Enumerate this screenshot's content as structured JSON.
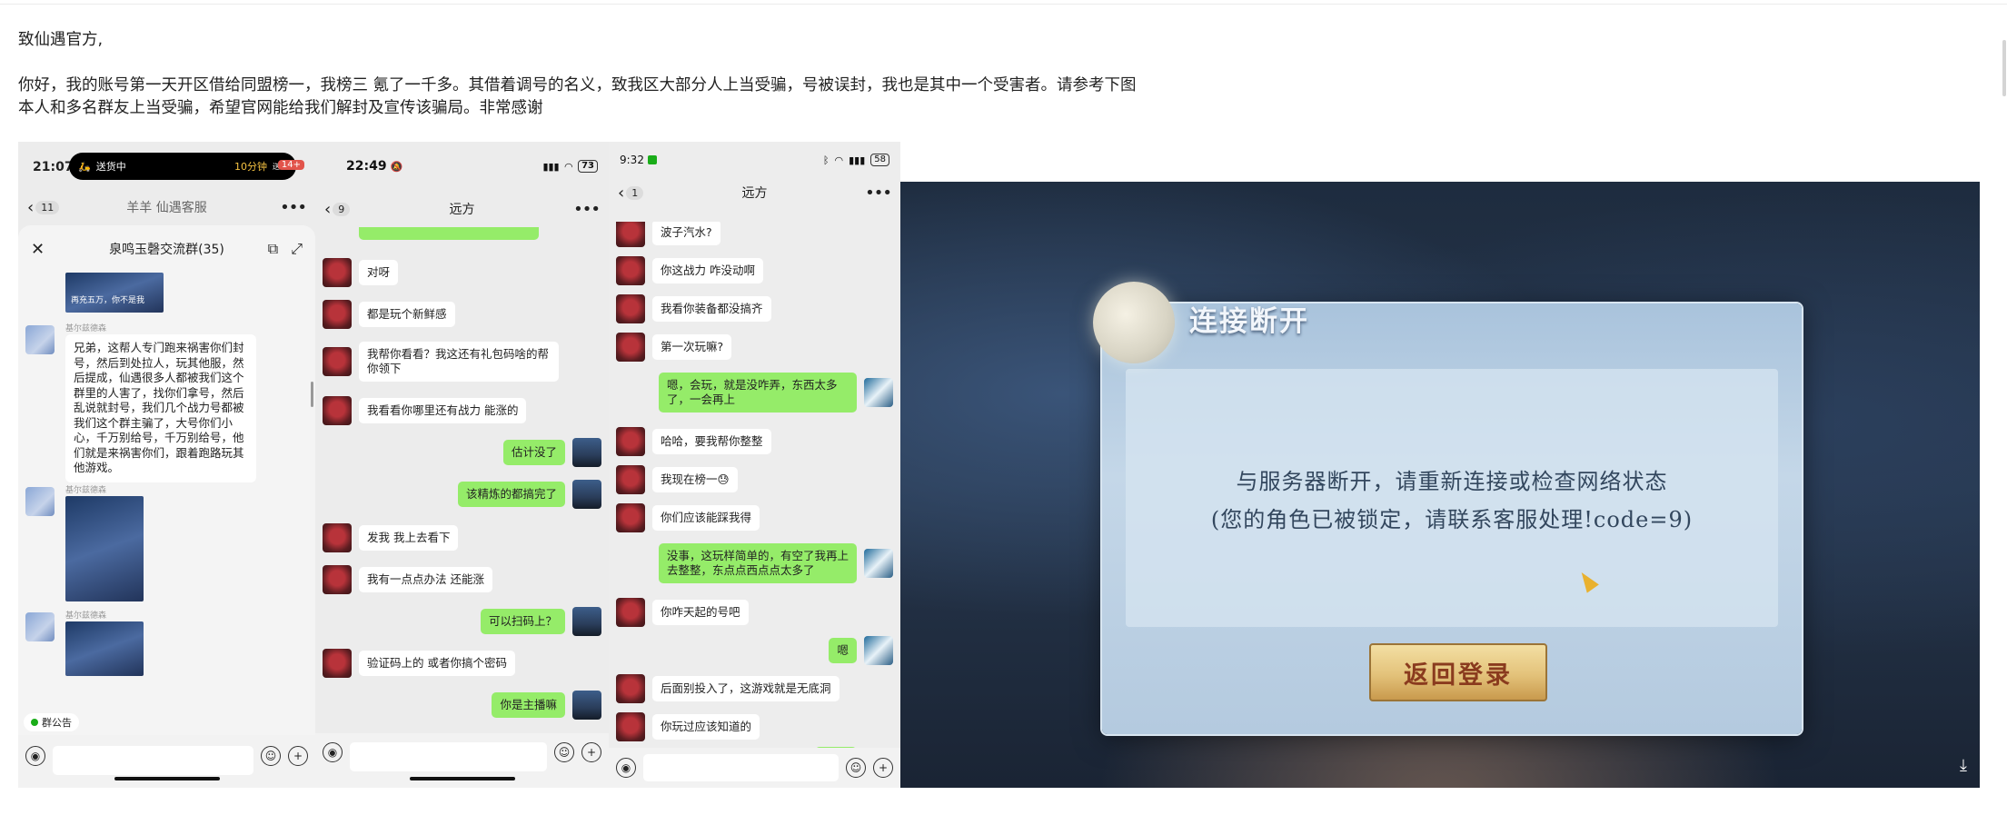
{
  "letter": {
    "salutation": "致仙遇官方,",
    "line1": "你好，我的账号第一天开区借给同盟榜一，我榜三 氪了一千多。其借着调号的名义，致我区大部分人上当受骗，号被误封，我也是其中一个受害者。请参考下图",
    "line2": "本人和多名群友上当受骗，希望官网能给我们解封及宣传该骗局。非常感谢"
  },
  "shot1": {
    "time": "21:07",
    "island_label": "送货中",
    "island_eta": "10分钟",
    "island_eta_suffix": "送达",
    "battery": "14+",
    "back_count": "11",
    "nav_title": "羊羊 仙遇客服",
    "sheet_title": "泉鸣玉磬交流群(35)",
    "image_caption": "再充五万，你不是我",
    "nick": "基尔兹德森",
    "message": "兄弟，这帮人专门跑来祸害你们封号，然后到处拉人，玩其他服，然后提成，仙遇很多人都被我们这个群里的人害了，找你们拿号，然后乱说就封号，我们几个战力号都被我们这个群主骗了，大号你们小心，千万别给号，千万别给号，他们就是来祸害你们，跟着跑路玩其他游戏。",
    "notice": "群公告"
  },
  "shot2": {
    "time": "22:49",
    "battery": "73",
    "back_count": "9",
    "nav_title": "远方",
    "messages": [
      {
        "side": "left",
        "text": "对呀"
      },
      {
        "side": "left",
        "text": "都是玩个新鲜感"
      },
      {
        "side": "left",
        "text": "我帮你看看？我这还有礼包码啥的帮你领下"
      },
      {
        "side": "left",
        "text": "我看看你哪里还有战力 能涨的"
      },
      {
        "side": "right",
        "text": "估计没了"
      },
      {
        "side": "right",
        "text": "该精炼的都搞完了"
      },
      {
        "side": "left",
        "text": "发我 我上去看下"
      },
      {
        "side": "left",
        "text": "我有一点点办法 还能涨"
      },
      {
        "side": "right",
        "text": "可以扫码上？"
      },
      {
        "side": "left",
        "text": "验证码上的 或者你搞个密码"
      },
      {
        "side": "right",
        "text": "你是主播嘛"
      }
    ]
  },
  "shot3": {
    "time": "9:32",
    "battery": "58",
    "back_count": "1",
    "nav_title": "远方",
    "messages": [
      {
        "side": "left",
        "text": "波子汽水?"
      },
      {
        "side": "left",
        "text": "你这战力 咋没动啊"
      },
      {
        "side": "left",
        "text": "我看你装备都没搞齐"
      },
      {
        "side": "left",
        "text": "第一次玩嘛?"
      },
      {
        "side": "right",
        "text": "嗯，会玩，就是没咋弄，东西太多了，一会再上"
      },
      {
        "side": "left",
        "text": "哈哈，要我帮你整整"
      },
      {
        "side": "left",
        "text": "我现在榜一😓"
      },
      {
        "side": "left",
        "text": "你们应该能踩我得"
      },
      {
        "side": "right",
        "text": "没事，这玩样简单的，有空了我再上去整整，东点点西点点太多了"
      },
      {
        "side": "left",
        "text": "你咋天起的号吧"
      },
      {
        "side": "right",
        "text": "嗯"
      },
      {
        "side": "left",
        "text": "后面别投入了，这游戏就是无底洞"
      },
      {
        "side": "left",
        "text": "你玩过应该知道的"
      }
    ]
  },
  "shot4": {
    "dialog_title": "连接断开",
    "message_line1": "与服务器断开，请重新连接或检查网络状态",
    "message_line2": "(您的角色已被锁定，请联系客服处理!code=9)",
    "button_label": "返回登录"
  }
}
